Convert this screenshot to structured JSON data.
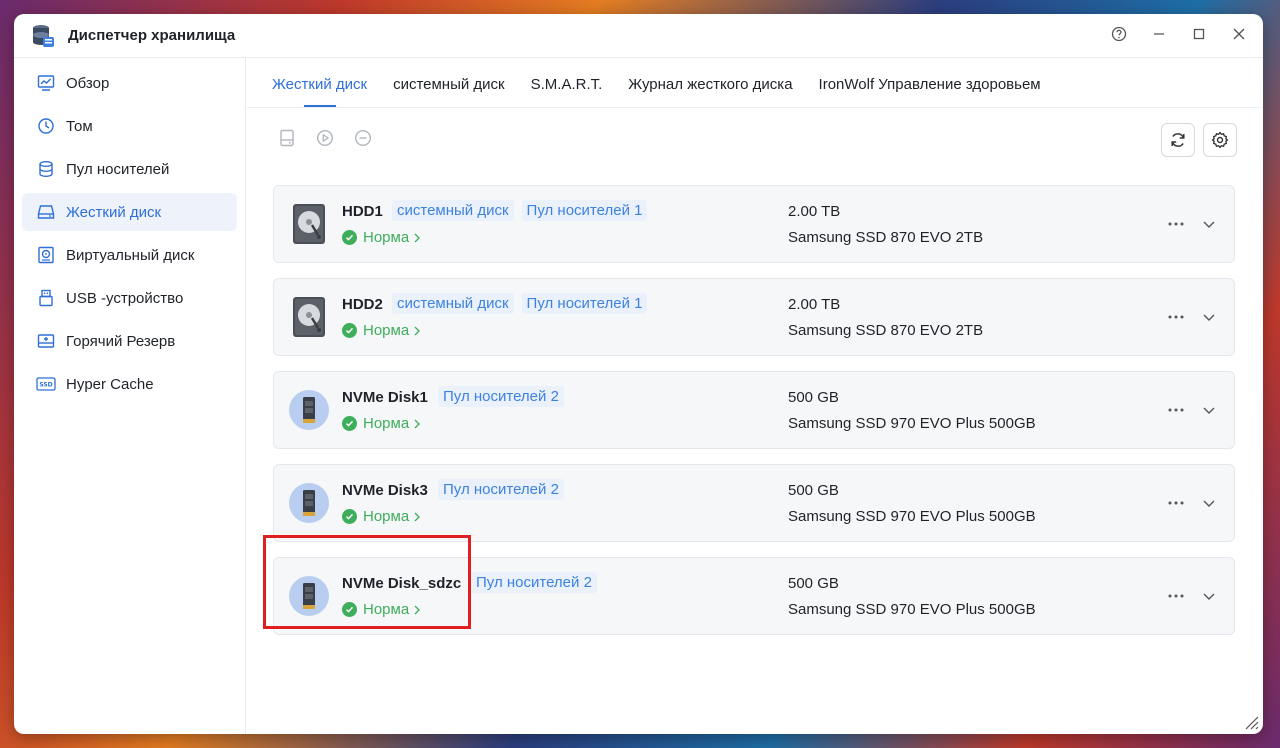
{
  "window": {
    "title": "Диспетчер хранилища"
  },
  "sidebar": {
    "items": [
      {
        "label": "Обзор",
        "icon": "chart-icon"
      },
      {
        "label": "Том",
        "icon": "clock-icon"
      },
      {
        "label": "Пул носителей",
        "icon": "database-icon"
      },
      {
        "label": "Жесткий диск",
        "icon": "drive-icon",
        "active": true
      },
      {
        "label": "Виртуальный диск",
        "icon": "virtual-disk-icon"
      },
      {
        "label": "USB -устройство",
        "icon": "usb-icon"
      },
      {
        "label": "Горячий Резерв",
        "icon": "hot-spare-icon"
      },
      {
        "label": "Hyper Cache",
        "icon": "ssd-icon"
      }
    ]
  },
  "tabs": [
    {
      "label": "Жесткий диск",
      "active": true
    },
    {
      "label": "системный диск"
    },
    {
      "label": "S.M.A.R.T."
    },
    {
      "label": "Журнал жесткого диска"
    },
    {
      "label": "IronWolf Управление здоровьем"
    }
  ],
  "disks": [
    {
      "name": "HDD1",
      "type": "hdd",
      "badges": [
        "системный диск",
        "Пул носителей 1"
      ],
      "status": "Норма",
      "capacity": "2.00 TB",
      "model": "Samsung SSD 870 EVO 2TB"
    },
    {
      "name": "HDD2",
      "type": "hdd",
      "badges": [
        "системный диск",
        "Пул носителей 1"
      ],
      "status": "Норма",
      "capacity": "2.00 TB",
      "model": "Samsung SSD 870 EVO 2TB"
    },
    {
      "name": "NVMe Disk1",
      "type": "nvme",
      "badges": [
        "Пул носителей 2"
      ],
      "status": "Норма",
      "capacity": "500 GB",
      "model": "Samsung SSD 970 EVO Plus 500GB"
    },
    {
      "name": "NVMe Disk3",
      "type": "nvme",
      "badges": [
        "Пул носителей 2"
      ],
      "status": "Норма",
      "capacity": "500 GB",
      "model": "Samsung SSD 970 EVO Plus 500GB"
    },
    {
      "name": "NVMe Disk_sdzc",
      "type": "nvme",
      "badges": [
        "Пул носителей 2"
      ],
      "status": "Норма",
      "capacity": "500 GB",
      "model": "Samsung SSD 970 EVO Plus 500GB"
    }
  ],
  "colors": {
    "accent": "#2f6fd8",
    "ok": "#3fae5b",
    "highlight": "#e02020"
  }
}
